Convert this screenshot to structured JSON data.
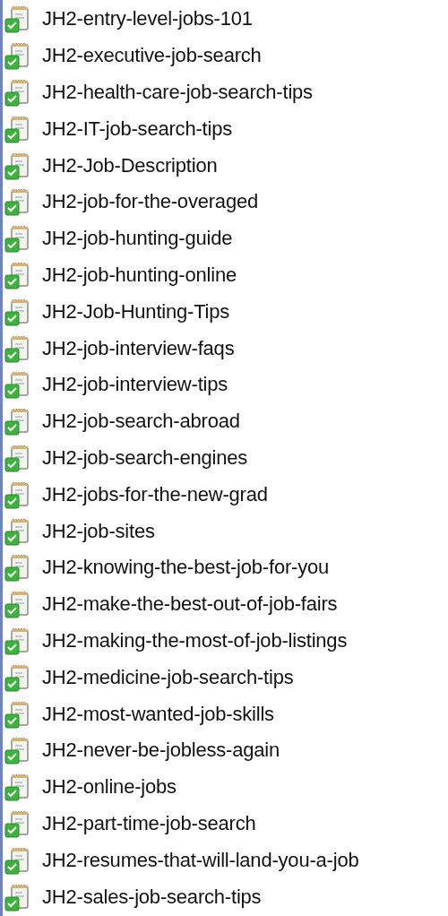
{
  "files": [
    {
      "name": "JH2-entry-level-jobs-101"
    },
    {
      "name": "JH2-executive-job-search"
    },
    {
      "name": "JH2-health-care-job-search-tips"
    },
    {
      "name": "JH2-IT-job-search-tips"
    },
    {
      "name": "JH2-Job-Description"
    },
    {
      "name": "JH2-job-for-the-overaged"
    },
    {
      "name": "JH2-job-hunting-guide"
    },
    {
      "name": "JH2-job-hunting-online"
    },
    {
      "name": "JH2-Job-Hunting-Tips"
    },
    {
      "name": "JH2-job-interview-faqs"
    },
    {
      "name": "JH2-job-interview-tips"
    },
    {
      "name": "JH2-job-search-abroad"
    },
    {
      "name": "JH2-job-search-engines"
    },
    {
      "name": "JH2-jobs-for-the-new-grad"
    },
    {
      "name": "JH2-job-sites"
    },
    {
      "name": "JH2-knowing-the-best-job-for-you"
    },
    {
      "name": "JH2-make-the-best-out-of-job-fairs"
    },
    {
      "name": "JH2-making-the-most-of-job-listings"
    },
    {
      "name": "JH2-medicine-job-search-tips"
    },
    {
      "name": "JH2-most-wanted-job-skills"
    },
    {
      "name": "JH2-never-be-jobless-again"
    },
    {
      "name": "JH2-online-jobs"
    },
    {
      "name": "JH2-part-time-job-search"
    },
    {
      "name": "JH2-resumes-that-will-land-you-a-job"
    },
    {
      "name": "JH2-sales-job-search-tips"
    }
  ]
}
